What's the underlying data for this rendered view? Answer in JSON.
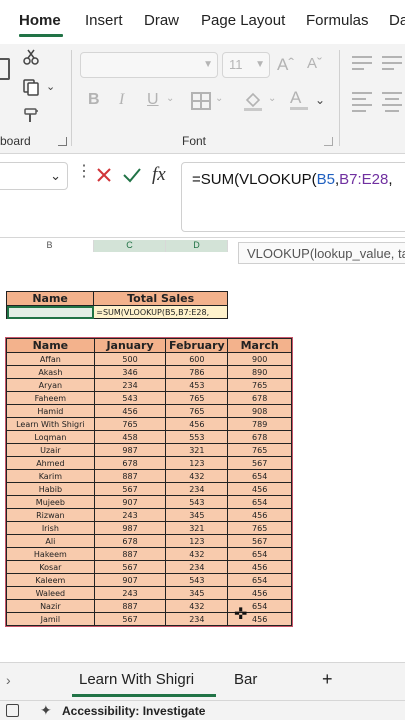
{
  "ribbon_tabs": [
    "Home",
    "Insert",
    "Draw",
    "Page Layout",
    "Formulas",
    "Da"
  ],
  "ribbon": {
    "font_name_value": "",
    "font_size_value": "11",
    "bold": "B",
    "italic": "I",
    "underline": "U",
    "group_clipboard": "board",
    "group_font": "Font"
  },
  "formula_bar": {
    "name_box": "",
    "formula_prefix": "=SUM(VLOOKUP(",
    "formula_ref1": "B5",
    "formula_sep": ",",
    "formula_ref2": "B7:E28",
    "formula_suffix": ","
  },
  "grid": {
    "column_headers": [
      "B",
      "C",
      "D"
    ],
    "tooltip": "VLOOKUP(lookup_value, ta"
  },
  "lookup_table": {
    "headers": [
      "Name",
      "Total Sales"
    ],
    "formula_cell": "=SUM(VLOOKUP(B5,B7:E28,"
  },
  "sales_table": {
    "headers": [
      "Name",
      "January",
      "February",
      "March"
    ],
    "rows": [
      [
        "Affan",
        "500",
        "600",
        "900"
      ],
      [
        "Akash",
        "346",
        "786",
        "890"
      ],
      [
        "Aryan",
        "234",
        "453",
        "765"
      ],
      [
        "Faheem",
        "543",
        "765",
        "678"
      ],
      [
        "Hamid",
        "456",
        "765",
        "908"
      ],
      [
        "Learn With Shigri",
        "765",
        "456",
        "789"
      ],
      [
        "Loqman",
        "458",
        "553",
        "678"
      ],
      [
        "Uzair",
        "987",
        "321",
        "765"
      ],
      [
        "Ahmed",
        "678",
        "123",
        "567"
      ],
      [
        "Karim",
        "887",
        "432",
        "654"
      ],
      [
        "Habib",
        "567",
        "234",
        "456"
      ],
      [
        "Mujeeb",
        "907",
        "543",
        "654"
      ],
      [
        "Rizwan",
        "243",
        "345",
        "456"
      ],
      [
        "Irish",
        "987",
        "321",
        "765"
      ],
      [
        "Ali",
        "678",
        "123",
        "567"
      ],
      [
        "Hakeem",
        "887",
        "432",
        "654"
      ],
      [
        "Kosar",
        "567",
        "234",
        "456"
      ],
      [
        "Kaleem",
        "907",
        "543",
        "654"
      ],
      [
        "Waleed",
        "243",
        "345",
        "456"
      ],
      [
        "Nazir",
        "887",
        "432",
        "654"
      ],
      [
        "Jamil",
        "567",
        "234",
        "456"
      ]
    ]
  },
  "sheets": {
    "active": "Learn With Shigri",
    "other": "Bar",
    "add": "+"
  },
  "status": {
    "accessibility": "Accessibility: Investigate"
  },
  "colors": {
    "accent": "#217346",
    "header_fill": "#f3b28c",
    "data_fill": "#f8cbad"
  }
}
